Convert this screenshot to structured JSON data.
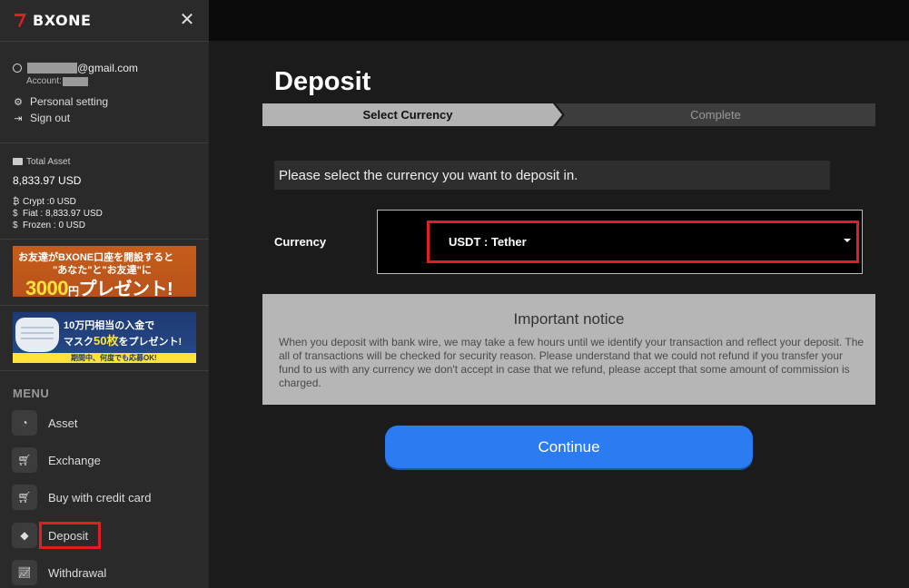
{
  "brand": {
    "name": "BXONE",
    "accent": "#e31d24"
  },
  "account": {
    "email_suffix": "@gmail.com",
    "account_label": "Account:",
    "personal_setting": "Personal setting",
    "sign_out": "Sign out"
  },
  "asset": {
    "title": "Total Asset",
    "total": "8,833.97 USD",
    "crypt_label": "Crypt :",
    "crypt_value": "0 USD",
    "fiat_label": "Fiat :",
    "fiat_value": "8,833.97 USD",
    "frozen_label": "Frozen :",
    "frozen_value": "0 USD"
  },
  "banners": {
    "b1_line1": "お友達がBXONE口座を開設すると",
    "b1_line2": "\"あなた\"と\"お友達\"に",
    "b1_amount": "3000",
    "b1_unit": "円",
    "b1_suffix": "プレゼント!",
    "b2_line1": "10万円相当の入金で",
    "b2_line2_a": "マスク",
    "b2_line2_num": "50枚",
    "b2_line2_b": "をプレゼント!",
    "b2_line3": "期間中、何度でも応募OK!"
  },
  "menu": {
    "heading": "MENU",
    "items": [
      {
        "label": "Asset",
        "icon": "gauge-icon"
      },
      {
        "label": "Exchange",
        "icon": "cart-icon"
      },
      {
        "label": "Buy with credit card",
        "icon": "cart-icon"
      },
      {
        "label": "Deposit",
        "icon": "diamond-icon"
      },
      {
        "label": "Withdrawal",
        "icon": "chart-icon"
      }
    ]
  },
  "page": {
    "title": "Deposit",
    "steps": [
      "Select Currency",
      "Complete"
    ],
    "instruction": "Please select the currency you want to deposit in.",
    "currency_label": "Currency",
    "currency_selected": "USDT : Tether",
    "notice_title": "Important notice",
    "notice_body": "When you deposit with bank wire, we may take a few hours until we identify your transaction and reflect your deposit. The all of transactions will be checked for security reason. Please understand that we could not refund if you transfer your fund to us with any currency we don't accept in case that we refund, please accept that some amount of commission is charged.",
    "continue_label": "Continue"
  },
  "colors": {
    "highlight": "#e31d24",
    "button": "#2b7bf1",
    "sidebar_bg": "#2a2a2a"
  }
}
